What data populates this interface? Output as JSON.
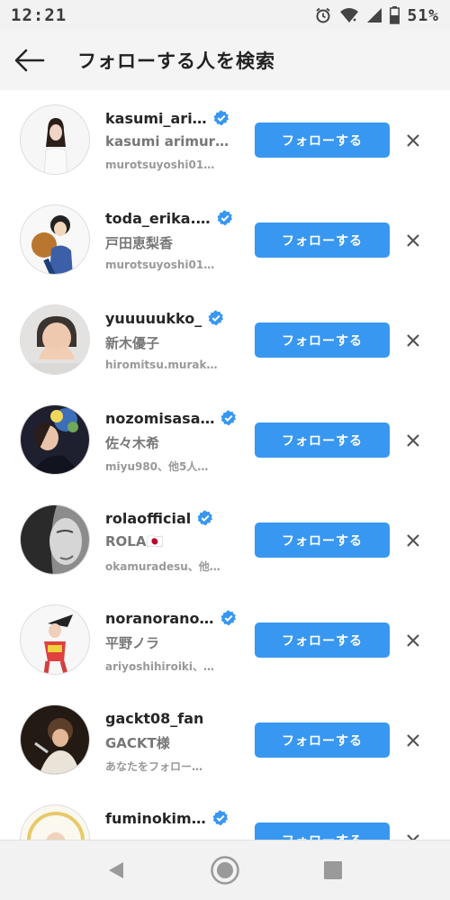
{
  "status_bar": {
    "time": "12:21",
    "battery": "51%",
    "icons": [
      "alarm-icon",
      "wifi-icon",
      "signal-icon",
      "battery-icon"
    ]
  },
  "header": {
    "back_icon": "arrow-left-icon",
    "title": "フォローする人を検索"
  },
  "colors": {
    "accent": "#3897f0",
    "verified": "#3897f0",
    "header_bg": "#f4f4f4"
  },
  "suggestions": [
    {
      "username": "kasumi_ari…",
      "verified": true,
      "full_name": "kasumi arimur…",
      "subtext": "murotsuyoshi01…",
      "follow_label": "フォローする"
    },
    {
      "username": "toda_erika.…",
      "verified": true,
      "full_name": "戸田恵梨香",
      "subtext": "murotsuyoshi01…",
      "follow_label": "フォローする"
    },
    {
      "username": "yuuuuukko_",
      "verified": true,
      "full_name": "新木優子",
      "subtext": "hiromitsu.murak…",
      "follow_label": "フォローする"
    },
    {
      "username": "nozomisasa…",
      "verified": true,
      "full_name": "佐々木希",
      "subtext": "miyu980、他5人…",
      "follow_label": "フォローする"
    },
    {
      "username": "rolaofficial",
      "verified": true,
      "full_name": "ROLA🇯🇵",
      "subtext": "okamuradesu、他…",
      "follow_label": "フォローする"
    },
    {
      "username": "noranorano…",
      "verified": true,
      "full_name": "平野ノラ",
      "subtext": "ariyoshihiroiki、…",
      "follow_label": "フォローする"
    },
    {
      "username": "gackt08_fan",
      "verified": false,
      "full_name": "GACKT様",
      "subtext": "あなたをフォロー…",
      "follow_label": "フォローする"
    },
    {
      "username": "fuminokim…",
      "verified": true,
      "full_name": "",
      "subtext": "",
      "follow_label": "フォローする"
    }
  ],
  "nav_bar": {
    "icons": [
      "back-triangle-icon",
      "home-circle-icon",
      "recent-square-icon"
    ]
  }
}
